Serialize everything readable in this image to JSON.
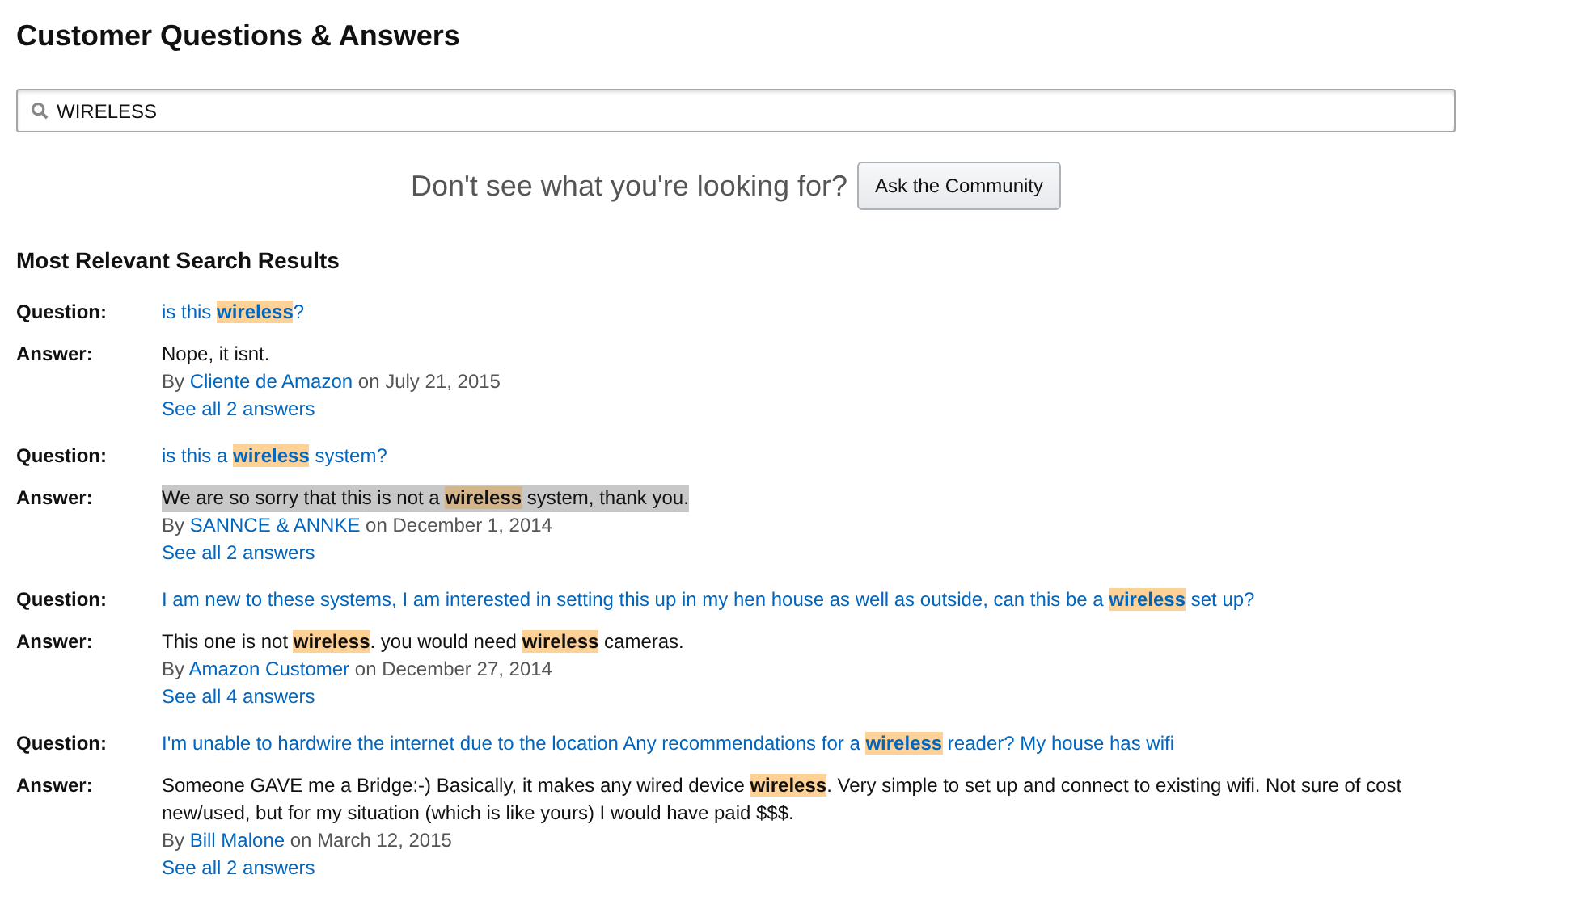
{
  "title": "Customer Questions & Answers",
  "search": {
    "value": "WIRELESS"
  },
  "prompt": {
    "text": "Don't see what you're looking for?",
    "button": "Ask the Community"
  },
  "results_heading": "Most Relevant Search Results",
  "results": [
    {
      "question_label": "Question:",
      "question": "is this **wireless**?",
      "answer_label": "Answer:",
      "answer": "Nope, it isnt.",
      "text_selected": false,
      "byline": {
        "lead": "By",
        "author": "Cliente de Amazon",
        "date": "on July 21, 2015"
      },
      "see_all": "See all 2 answers"
    },
    {
      "question_label": "Question:",
      "question": "is this a **wireless** system?",
      "answer_label": "Answer:",
      "answer": "We are so sorry that this is not a **wireless** system, thank you.",
      "text_selected": true,
      "byline": {
        "lead": "By",
        "author": "SANNCE & ANNKE",
        "date": "on December 1, 2014"
      },
      "see_all": "See all 2 answers"
    },
    {
      "question_label": "Question:",
      "question": "I am new to these systems, I am interested in setting this up in my hen house as well as outside, can this be a **wireless** set up?",
      "answer_label": "Answer:",
      "answer": "This one is not **wireless**. you would need **wireless** cameras.",
      "text_selected": false,
      "byline": {
        "lead": "By",
        "author": "Amazon Customer",
        "date": "on December 27, 2014"
      },
      "see_all": "See all 4 answers"
    },
    {
      "question_label": "Question:",
      "question": "I'm unable to hardwire the internet due to the location Any recommendations for a **wireless** reader? My house has wifi",
      "answer_label": "Answer:",
      "answer": "Someone GAVE me a Bridge:-) Basically, it makes any wired device **wireless**. Very simple to set up and connect to existing wifi. Not sure of cost new/used, but for my situation (which is like yours) I would have paid $$$.",
      "text_selected": false,
      "byline": {
        "lead": "By",
        "author": "Bill Malone",
        "date": "on March 12, 2015"
      },
      "see_all": "See all 2 answers"
    }
  ]
}
